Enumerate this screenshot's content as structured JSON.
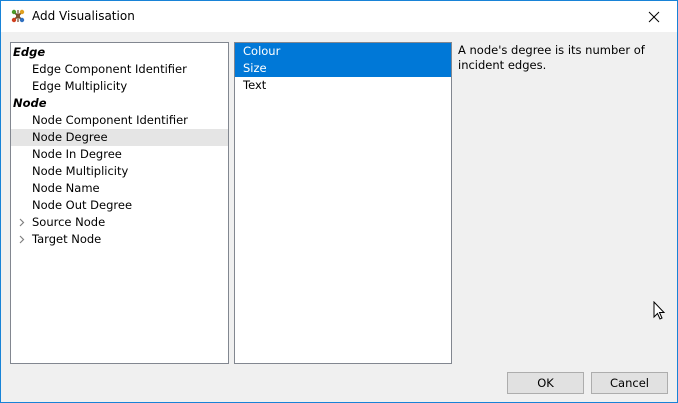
{
  "window": {
    "title": "Add Visualisation",
    "icon": "tree-graph-app-icon",
    "close_icon": "close-icon"
  },
  "attribute_tree": {
    "groups": [
      {
        "label": "Edge",
        "items": [
          {
            "label": "Edge Component Identifier"
          },
          {
            "label": "Edge Multiplicity"
          }
        ]
      },
      {
        "label": "Node",
        "items": [
          {
            "label": "Node Component Identifier"
          },
          {
            "label": "Node Degree",
            "hovered": true
          },
          {
            "label": "Node In Degree"
          },
          {
            "label": "Node Multiplicity"
          },
          {
            "label": "Node Name"
          },
          {
            "label": "Node Out Degree"
          },
          {
            "label": "Source Node",
            "expandable": true,
            "expander_icon": "chevron-right-icon"
          },
          {
            "label": "Target Node",
            "expandable": true,
            "expander_icon": "chevron-right-icon"
          }
        ]
      }
    ]
  },
  "visualisation_types": {
    "items": [
      {
        "label": "Colour",
        "selected": true
      },
      {
        "label": "Size",
        "selected": true
      },
      {
        "label": "Text",
        "selected": false
      }
    ],
    "selection_color": "#0078d7"
  },
  "description": "A node's degree is its number of incident edges.",
  "buttons": {
    "ok": "OK",
    "cancel": "Cancel"
  }
}
